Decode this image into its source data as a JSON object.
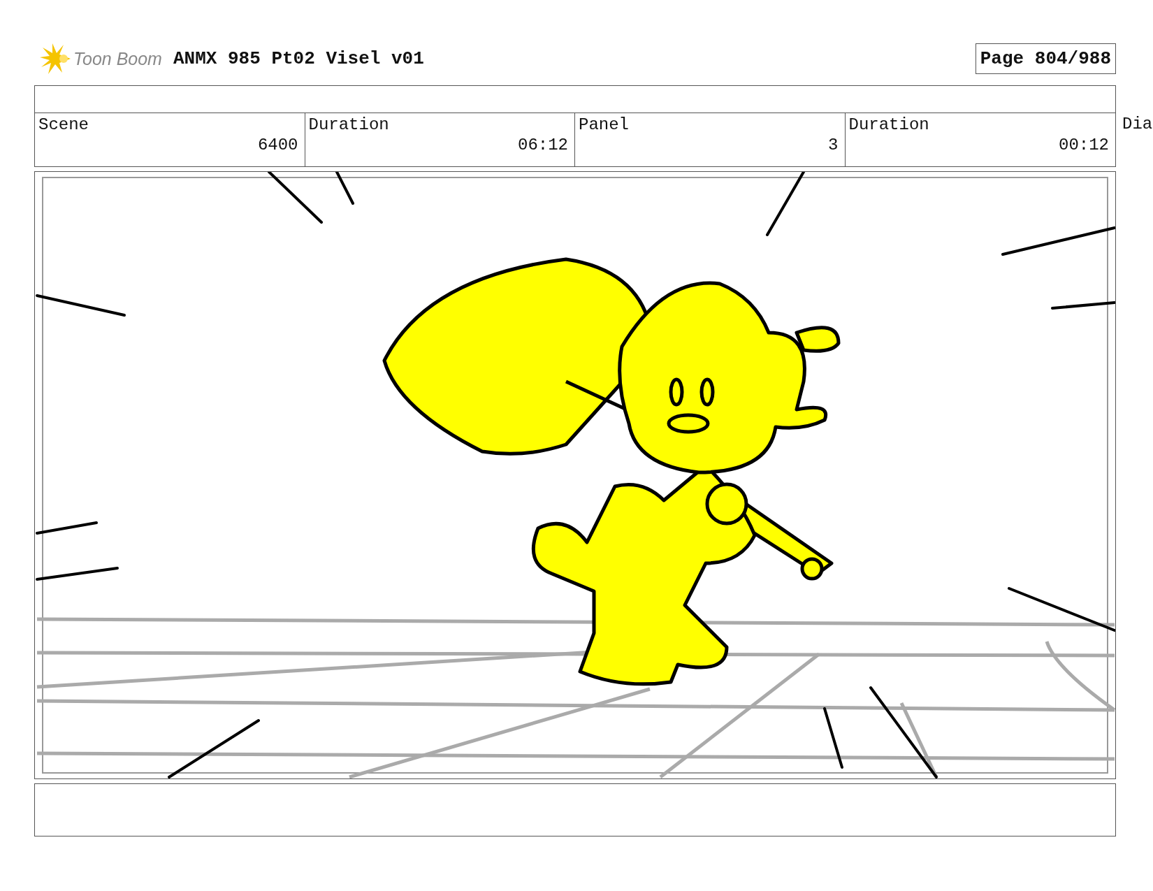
{
  "header": {
    "logo_text": "Toon Boom",
    "title": "ANMX 985 Pt02 Visel v01",
    "page": "Page 804/988"
  },
  "table": {
    "labels": [
      "Scene",
      "Duration",
      "Panel",
      "Duration"
    ],
    "values": [
      "6400",
      "06:12",
      "3",
      "00:12"
    ]
  },
  "cut_field_label": "Dia"
}
